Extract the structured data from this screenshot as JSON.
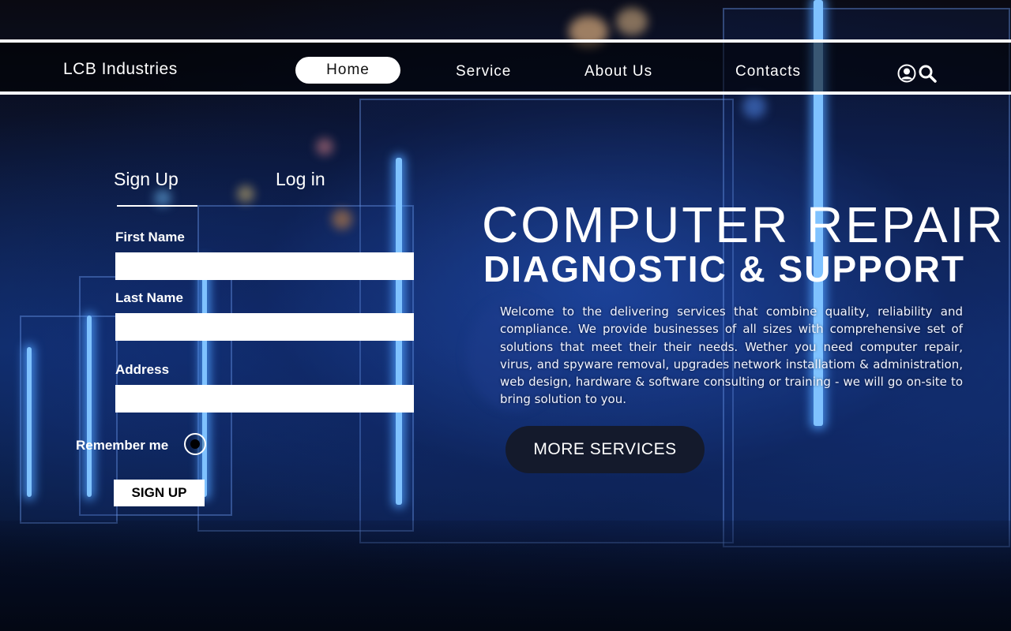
{
  "nav": {
    "brand": "LCB Industries",
    "items": [
      {
        "label": "Home",
        "active": true
      },
      {
        "label": "Service",
        "active": false
      },
      {
        "label": "About Us",
        "active": false
      },
      {
        "label": "Contacts",
        "active": false
      }
    ],
    "icons": [
      "user-icon",
      "search-icon"
    ]
  },
  "form": {
    "tabs": [
      "Sign Up",
      "Log in"
    ],
    "active_tab": "Sign Up",
    "fields": [
      {
        "label": "First Name",
        "value": "",
        "placeholder": ""
      },
      {
        "label": "Last Name",
        "value": "",
        "placeholder": ""
      },
      {
        "label": "Address",
        "value": "",
        "placeholder": ""
      }
    ],
    "remember_label": "Remember me",
    "submit_label": "SIGN UP"
  },
  "hero": {
    "title": "COMPUTER REPAIR",
    "subtitle": "DIAGNOSTIC & SUPPORT",
    "description": "Welcome to the delivering services that combine quality, reliability and compliance. We provide businesses of all sizes with comprehensive set of solutions that meet their their needs. Wether you need computer repair, virus, and spyware removal, upgrades network installatiom & administration, web design, hardware & software consulting or training - we will go on-site to bring solution to you.",
    "cta_label": "MORE SERVICES"
  },
  "colors": {
    "background": "#0d2252",
    "accent_glow": "#7fc2ff",
    "cta_background": "#141a2c",
    "nav_active_bg": "#ffffff"
  }
}
